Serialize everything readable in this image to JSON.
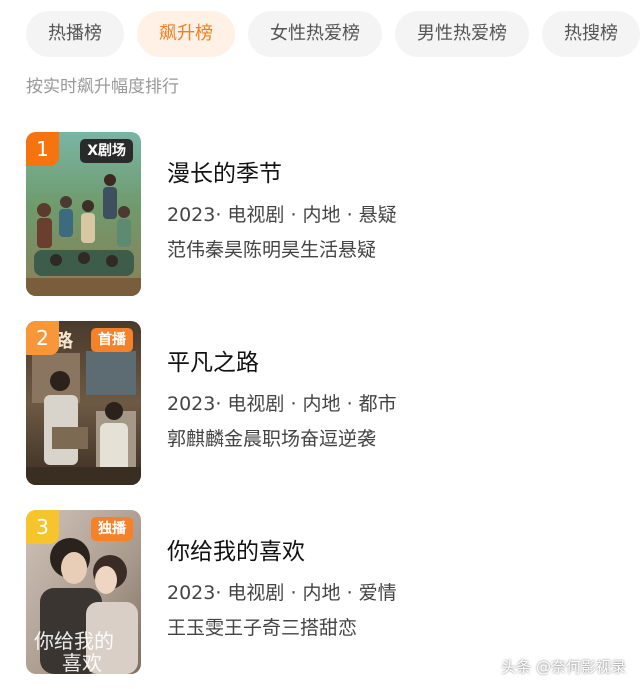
{
  "tabs": [
    {
      "label": "热播榜",
      "active": false
    },
    {
      "label": "飙升榜",
      "active": true
    },
    {
      "label": "女性热爱榜",
      "active": false
    },
    {
      "label": "男性热爱榜",
      "active": false
    },
    {
      "label": "热搜榜",
      "active": false
    }
  ],
  "subtitle": "按实时飙升幅度排行",
  "items": [
    {
      "rank": "1",
      "rank_color": "#f5740f",
      "badge": "剧场",
      "badge_color": "#2a2a2a",
      "badge_icon": "x-brand-icon",
      "title": "漫长的季节",
      "meta": "2023· 电视剧 · 内地 · 悬疑",
      "desc": "范伟秦昊陈明昊生活悬疑"
    },
    {
      "rank": "2",
      "rank_color": "#f7973a",
      "badge": "首播",
      "badge_color": "#f5822a",
      "badge_icon": "",
      "title": "平凡之路",
      "meta": "2023· 电视剧 · 内地 · 都市",
      "desc": "郭麒麟金晨职场奋逗逆袭"
    },
    {
      "rank": "3",
      "rank_color": "#f6c52b",
      "badge": "独播",
      "badge_color": "#f5822a",
      "badge_icon": "",
      "title": "你给我的喜欢",
      "meta": "2023· 电视剧 · 内地 · 爱情",
      "desc": "王玉雯王子奇三搭甜恋"
    }
  ],
  "watermark": "头条 @奈何影视录"
}
